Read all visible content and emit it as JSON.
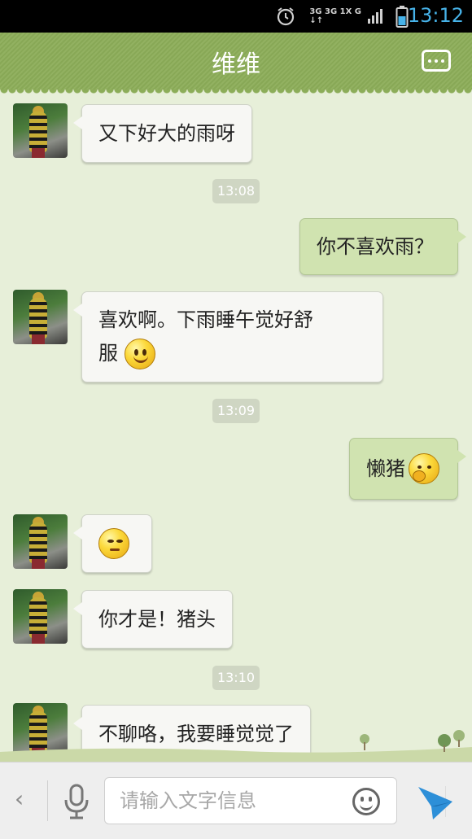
{
  "status_bar": {
    "network_top": "3G 3G 1X G",
    "network_bottom": "↓↑",
    "time": "13:12",
    "accent_color": "#47b3e9"
  },
  "header": {
    "title": "维维",
    "menu_icon": "more-dots-icon",
    "background_color": "#8cad59"
  },
  "messages": [
    {
      "side": "left",
      "text": "又下好大的雨呀"
    },
    {
      "type": "time",
      "text": "13:08"
    },
    {
      "side": "right",
      "text": "你不喜欢雨？"
    },
    {
      "side": "left",
      "line1": "喜欢啊。下雨睡午觉好舒",
      "line2": "服",
      "emoji": "smile-emoji"
    },
    {
      "type": "time",
      "text": "13:09"
    },
    {
      "side": "right",
      "text": "懒猪",
      "emoji": "yawn-emoji"
    },
    {
      "side": "left",
      "emoji": "smirk-emoji"
    },
    {
      "side": "left",
      "text": "你才是！猪头"
    },
    {
      "type": "time",
      "text": "13:10"
    },
    {
      "side": "left",
      "text": "不聊咯，我要睡觉觉了"
    }
  ],
  "input_bar": {
    "back_icon": "chevron-left-icon",
    "voice_icon": "microphone-icon",
    "placeholder": "请输入文字信息",
    "emoji_icon": "smiley-icon",
    "send_icon": "send-plane-icon"
  },
  "colors": {
    "chat_background": "#e7efd9",
    "incoming_bubble": "#f7f7f4",
    "outgoing_bubble": "#d0e3b0",
    "send_icon": "#2d8fd8"
  }
}
